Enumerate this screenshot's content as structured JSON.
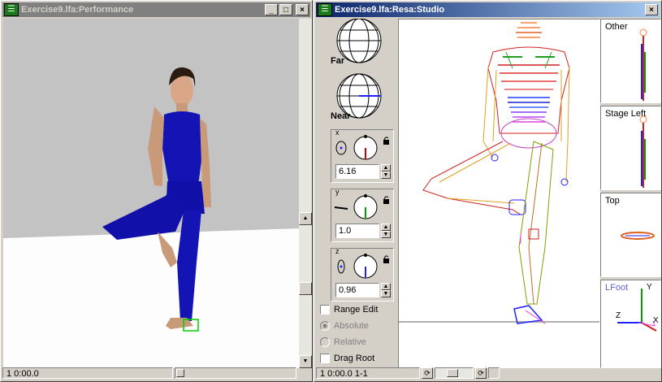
{
  "perf_window": {
    "title": "Exercise9.lfa:Performance",
    "status_frame": "1 0:00.0"
  },
  "studio_window": {
    "title": "Exercise9.lfa:Resa:Studio",
    "status_frame": "1 0:00.0 1-1"
  },
  "camera": {
    "far_label": "Far",
    "near_label": "Near",
    "x": {
      "label": "x",
      "value": "6.16"
    },
    "y": {
      "label": "y",
      "value": "1.0"
    },
    "z": {
      "label": "z",
      "value": "0.96"
    }
  },
  "options": {
    "range_edit": "Range Edit",
    "absolute": "Absolute",
    "relative": "Relative",
    "drag_root": "Drag Root"
  },
  "views": {
    "other": "Other",
    "stage_left": "Stage Left",
    "top": "Top",
    "lfoot": "LFoot",
    "axis_y": "Y",
    "axis_z": "Z",
    "axis_x": "X"
  },
  "colors": {
    "figure_blue": "#1414b4",
    "lfoot_label": "#6464d2",
    "active_title": "#0a246a"
  }
}
